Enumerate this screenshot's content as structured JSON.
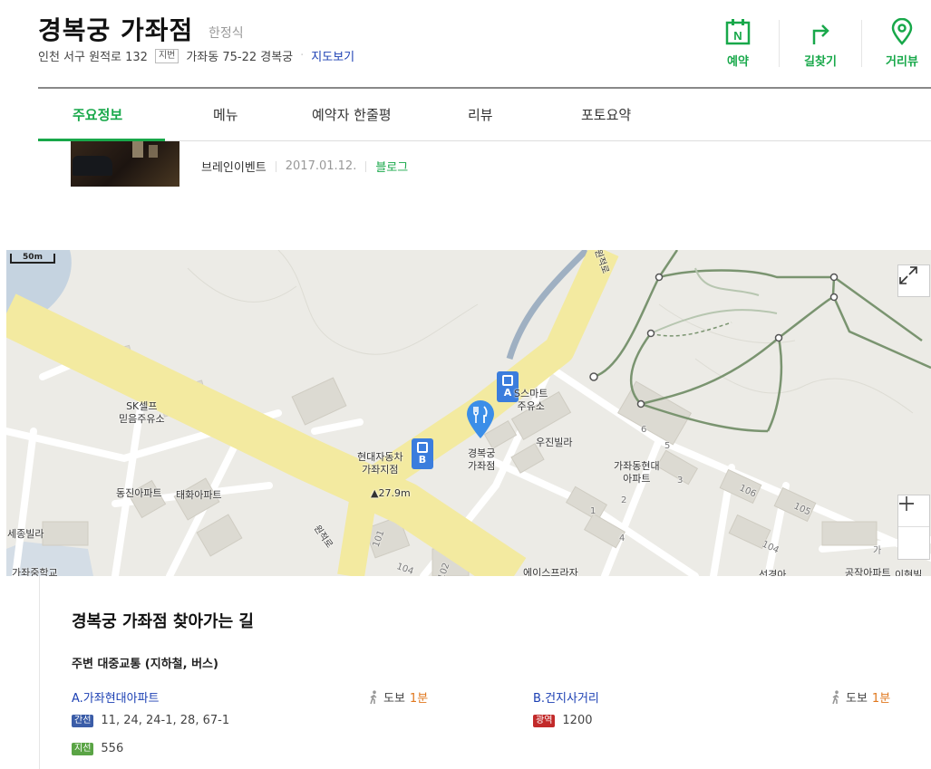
{
  "header": {
    "title": "경복궁 가좌점",
    "category": "한정식",
    "address_road": "인천 서구 원적로 132",
    "jibun_tag": "지번",
    "address_jibun": "가좌동 75-22 경복궁",
    "map_link": "지도보기",
    "actions": [
      {
        "label": "예약",
        "icon": "calendar-n-icon"
      },
      {
        "label": "길찾기",
        "icon": "turn-arrow-icon"
      },
      {
        "label": "거리뷰",
        "icon": "location-pin-icon"
      }
    ],
    "reserve_icon_letter": "N"
  },
  "tabs": [
    "주요정보",
    "메뉴",
    "예약자 한줄평",
    "리뷰",
    "포토요약"
  ],
  "blog": {
    "author": "브레인이벤트",
    "date": "2017.01.12.",
    "source": "블로그"
  },
  "map": {
    "scale_label": "50m",
    "elevation": "▲27.9m",
    "bus_stops": [
      "A",
      "B"
    ],
    "labels": {
      "sk": "SK셀프\n믿음주유소",
      "smart": "S스마트\n주유소",
      "dongjin": "동진아파트",
      "taehwa": "태화아파트",
      "sejong_villa": "세종빌라",
      "gajwa_middle": "가좌중학교",
      "hyundai_car": "현대자동차\n가좌지점",
      "restaurant": "경복궁\n가좌점",
      "ujin": "우진빌라",
      "gajwa_hyundai": "가좌동현대\n아파트",
      "road_wonjeok": "원적로",
      "road_wonjeok2": "원적로",
      "b101": "101",
      "b104a": "104",
      "b102": "102",
      "b106": "106",
      "b105": "105",
      "b104b": "104",
      "b1": "1",
      "b2": "2",
      "b6": "6",
      "b5": "5",
      "b3": "3",
      "b4": "4",
      "gongjak": "공작아파트",
      "ga": "가",
      "inhyeon": "이현빌",
      "seongyeong": "선경아",
      "acrossright": "에이스프라자"
    }
  },
  "directions": {
    "title": "경복궁 가좌점 찾아가는 길",
    "transit_heading": "주변 대중교통 (지하철, 버스)",
    "walk_label": "도보",
    "stops": [
      {
        "letter": "A.",
        "name": "가좌현대아파트",
        "walk_minutes": "1분",
        "routes": [
          {
            "type": "간선",
            "numbers": "11,  24,  24-1,  28,  67-1"
          },
          {
            "type": "지선",
            "numbers": "556"
          }
        ]
      },
      {
        "letter": "B.",
        "name": "건지사거리",
        "walk_minutes": "1분",
        "routes": [
          {
            "type": "광역",
            "numbers": "1200"
          }
        ]
      }
    ]
  },
  "colors": {
    "brand_green": "#18a84a",
    "link_blue": "#1b3fb3",
    "walk_orange": "#e0781e",
    "bus_blue": "#3b7ddd"
  }
}
